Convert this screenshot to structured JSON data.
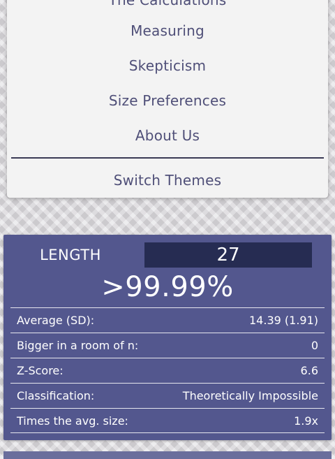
{
  "menu": {
    "items": [
      {
        "label": "The Calculations"
      },
      {
        "label": "Measuring"
      },
      {
        "label": "Skepticism"
      },
      {
        "label": "Size Preferences"
      },
      {
        "label": "About Us"
      }
    ],
    "switch_themes": "Switch Themes"
  },
  "stats": {
    "length_label": "LENGTH",
    "length_value": "27",
    "percentile": ">99.99%",
    "rows": [
      {
        "label": "Average (SD):",
        "value": "14.39 (1.91)"
      },
      {
        "label": "Bigger in a room of n:",
        "value": "0"
      },
      {
        "label": "Z-Score:",
        "value": "6.6"
      },
      {
        "label": "Classification:",
        "value": "Theoretically Impossible"
      },
      {
        "label": "Times the avg. size:",
        "value": "1.9x"
      }
    ]
  },
  "colors": {
    "card_bg": "#53578e",
    "input_bg": "#262c52",
    "menu_text": "#4f4f78"
  }
}
